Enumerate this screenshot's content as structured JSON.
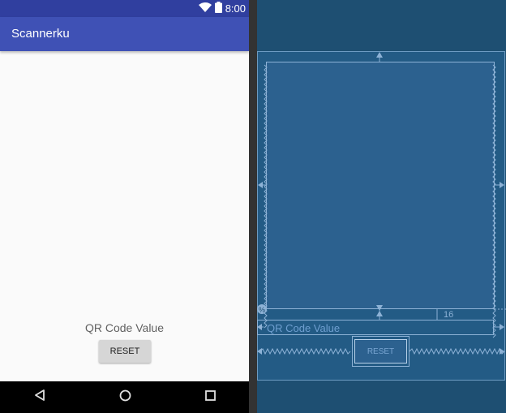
{
  "status_bar": {
    "time": "8:00",
    "icons": [
      "wifi-icon",
      "battery-icon"
    ]
  },
  "app_bar": {
    "title": "Scannerku"
  },
  "content": {
    "qr_label": "QR Code Value",
    "reset_label": "RESET"
  },
  "nav_bar": {
    "icons": [
      "back-icon",
      "home-icon",
      "recents-icon"
    ]
  },
  "blueprint": {
    "qr_label": "QR Code Value",
    "reset_label": "RESET",
    "margin_label": "16",
    "percent_badge": "%"
  },
  "colors": {
    "primary": "#3f51b5",
    "primary_dark": "#303f9f",
    "blueprint_bg": "#1e4f72",
    "blueprint_line": "#8db2d6"
  }
}
